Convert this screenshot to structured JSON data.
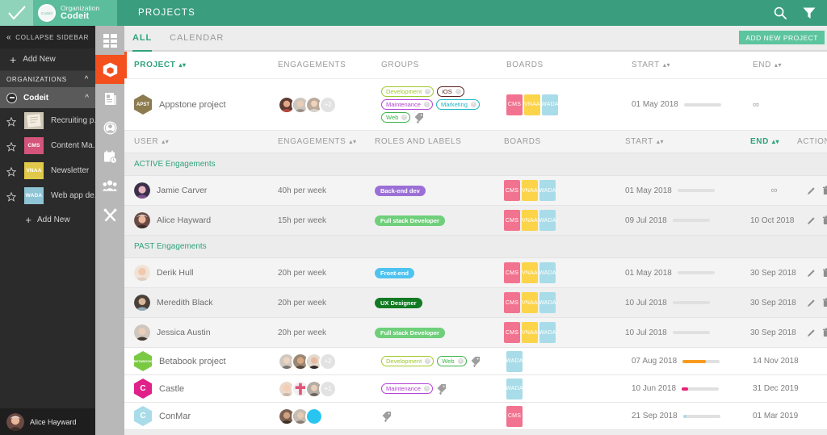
{
  "topbar": {
    "org_label": "Organization",
    "org_name": "Codeit",
    "org_avatar_text": "Codeit",
    "page_title": "PROJECTS",
    "search_icon": "search-icon",
    "filter_icon": "filter-icon",
    "brand_green": "#3a9e7e",
    "brand_light_green": "#5bbd9b"
  },
  "sidebar": {
    "collapse_label": "COLLAPSE SIDEBAR",
    "add_new_top": "Add New",
    "organizations_label": "ORGANIZATIONS",
    "current_org": "Codeit",
    "projects": [
      {
        "name": "Recruiting p...",
        "badge": "",
        "color": "#c8bfb2"
      },
      {
        "name": "Content Ma...",
        "badge": "CMS",
        "color": "#d4547b"
      },
      {
        "name": "Newsletter",
        "badge": "VNAA",
        "color": "#e0c94a"
      },
      {
        "name": "Web app de...",
        "badge": "WADA",
        "color": "#8fc4d4"
      }
    ],
    "add_new_bottom": "Add New",
    "user_name": "Alice Hayward"
  },
  "rail": {
    "items": [
      {
        "icon": "dashboard-grid-icon",
        "active": false
      },
      {
        "icon": "projects-box-icon",
        "active": true
      },
      {
        "icon": "documents-icon",
        "active": false
      },
      {
        "icon": "profile-badge-icon",
        "active": false
      },
      {
        "icon": "calendar-clock-icon",
        "active": false
      },
      {
        "icon": "team-people-icon",
        "active": false
      },
      {
        "icon": "tools-icon",
        "active": false
      }
    ],
    "active_color": "#f4501e"
  },
  "main": {
    "tabs": [
      {
        "label": "ALL",
        "active": true
      },
      {
        "label": "CALENDAR",
        "active": false
      }
    ],
    "add_project_button": "ADD NEW PROJECT",
    "project_columns": [
      "PROJECT",
      "ENGAGEMENTS",
      "GROUPS",
      "BOARDS",
      "START",
      "END"
    ],
    "user_columns": [
      "USER",
      "ENGAGEMENTS",
      "ROLES AND LABELS",
      "BOARDS",
      "START",
      "END",
      "ACTIONS"
    ]
  },
  "boards_palette": {
    "CMS": "#f2738f",
    "VNAA": "#fbd44a",
    "WADA": "#a8dce8"
  },
  "projects": [
    {
      "name": "Appstone project",
      "hex_color": "#8c7b4f",
      "hex_text": "APST",
      "avatars": 3,
      "avatar_more": "+2",
      "groups": [
        {
          "label": "Development",
          "color": "#9ec92c"
        },
        {
          "label": "iOS",
          "color": "#5c1f1f"
        },
        {
          "label": "Maintenance",
          "color": "#b442d6"
        },
        {
          "label": "Marketing",
          "color": "#1fb5c4"
        },
        {
          "label": "Web",
          "color": "#3cb34a"
        }
      ],
      "boards": [
        "CMS",
        "VNAA",
        "WADA"
      ],
      "start": "01 May 2018",
      "end": "∞",
      "progress": 0,
      "progress_color": "#cfcfcf",
      "expanded": true
    },
    {
      "name": "Betabook project",
      "hex_color": "#7ac943",
      "hex_text": "BETABOOK",
      "avatars": 3,
      "avatar_more": "+2",
      "groups": [
        {
          "label": "Development",
          "color": "#9ec92c"
        },
        {
          "label": "Web",
          "color": "#3cb34a"
        }
      ],
      "boards": [
        "WADA"
      ],
      "start": "07 Aug 2018",
      "end": "14 Nov 2018",
      "progress": 62,
      "progress_color": "#f79c1f",
      "expanded": false
    },
    {
      "name": "Castle",
      "hex_color": "#e0218a",
      "hex_text": "C",
      "avatars": 3,
      "avatar_more": "+1",
      "groups": [
        {
          "label": "Maintenance",
          "color": "#b442d6"
        }
      ],
      "boards": [
        "WADA"
      ],
      "start": "10 Jun 2018",
      "end": "31 Dec 2019",
      "progress": 17,
      "progress_color": "#ec1e79",
      "expanded": false
    },
    {
      "name": "ConMar",
      "hex_color": "#a8dce8",
      "hex_text": "C",
      "avatars": 3,
      "avatar_more": "",
      "groups": [],
      "boards": [
        "CMS"
      ],
      "start": "21 Sep 2018",
      "end": "01 Mar 2019",
      "progress": 9,
      "progress_color": "#a8dce8",
      "expanded": false
    }
  ],
  "engagements": {
    "active_label": "ACTIVE Engagements",
    "past_label": "PAST Engagements",
    "active": [
      {
        "user": "Jamie Carver",
        "engagement": "40h per week",
        "role": "Back-end dev",
        "role_color": "#9b6fd6",
        "boards": [
          "CMS",
          "VNAA",
          "WADA"
        ],
        "start": "01 May 2018",
        "end": "∞",
        "progress": 0,
        "progress_color": "#cfcfcf"
      },
      {
        "user": "Alice Hayward",
        "engagement": "15h per week",
        "role": "Full stack Developer",
        "role_color": "#6fcf7a",
        "boards": [
          "CMS",
          "VNAA",
          "WADA"
        ],
        "start": "09 Jul 2018",
        "end": "10 Oct 2018",
        "progress": 0,
        "progress_color": "#cfcfcf"
      }
    ],
    "past": [
      {
        "user": "Derik Hull",
        "engagement": "20h per week",
        "role": "Front-end",
        "role_color": "#4ec3f0",
        "boards": [
          "CMS",
          "VNAA",
          "WADA"
        ],
        "start": "01 May 2018",
        "end": "30 Sep 2018",
        "progress": 0,
        "progress_color": "#cfcfcf"
      },
      {
        "user": "Meredith Black",
        "engagement": "20h per week",
        "role": "UX Designer",
        "role_color": "#117a22",
        "boards": [
          "CMS",
          "VNAA",
          "WADA"
        ],
        "start": "10 Jul 2018",
        "end": "30 Sep 2018",
        "progress": 0,
        "progress_color": "#cfcfcf"
      },
      {
        "user": "Jessica Austin",
        "engagement": "20h per week",
        "role": "Full stack Developer",
        "role_color": "#6fcf7a",
        "boards": [
          "CMS",
          "VNAA",
          "WADA"
        ],
        "start": "10 Jul 2018",
        "end": "30 Sep 2018",
        "progress": 0,
        "progress_color": "#cfcfcf"
      }
    ],
    "edit_icon": "pencil-icon",
    "delete_icon": "trash-icon"
  }
}
